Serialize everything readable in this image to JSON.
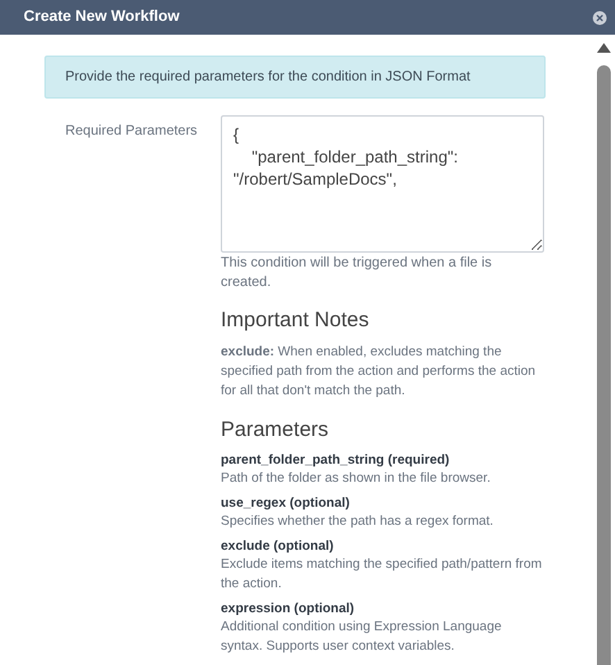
{
  "window": {
    "title": "Create New Workflow"
  },
  "alert": "Provide the required parameters for the condition in JSON Format",
  "field": {
    "label": "Required Parameters",
    "value": "{\n    \"parent_folder_path_string\": \"/robert/SampleDocs\",",
    "help": "This condition will be triggered when a file is created."
  },
  "notes": {
    "heading": "Important Notes",
    "text": "**exclude:** When enabled, excludes matching the specified path from the action and performs the action for all that don't match the path."
  },
  "parameters": {
    "heading": "Parameters",
    "items": [
      {
        "title": "parent_folder_path_string (required)",
        "description": "Path of the folder as shown in the file browser."
      },
      {
        "title": "use_regex (optional)",
        "description": "Specifies whether the path has a regex format."
      },
      {
        "title": "exclude (optional)",
        "description": "Exclude items matching the specified path/pattern from the action."
      },
      {
        "title": "expression (optional)",
        "description": "Additional condition using Expression Language syntax. Supports user context variables."
      }
    ]
  }
}
